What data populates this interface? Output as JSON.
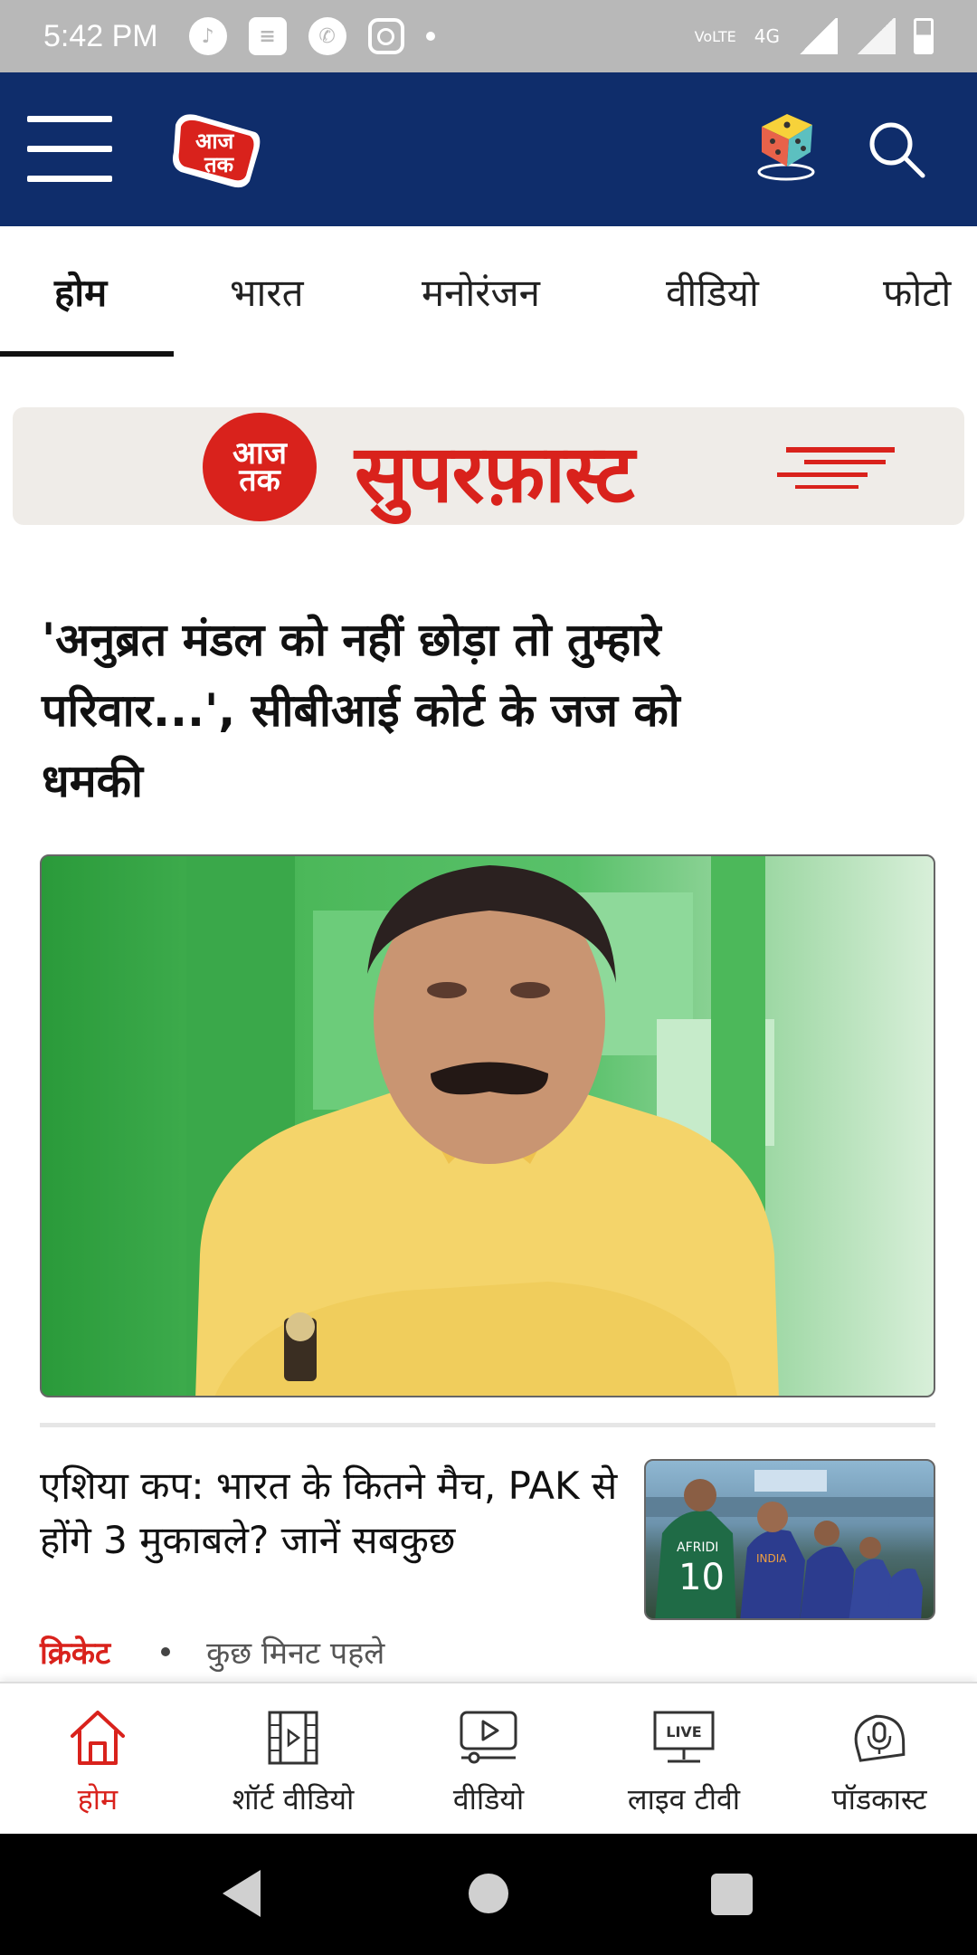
{
  "status_bar": {
    "time": "5:42 PM",
    "network": "4G",
    "volte": "VoLTE"
  },
  "header": {
    "logo_text_line1": "आज",
    "logo_text_line2": "तक"
  },
  "tabs": [
    {
      "label": "होम",
      "active": true
    },
    {
      "label": "भारत",
      "active": false
    },
    {
      "label": "मनोरंजन",
      "active": false
    },
    {
      "label": "वीडियो",
      "active": false
    },
    {
      "label": "फोटो",
      "active": false
    }
  ],
  "banner": {
    "logo_line1": "आज",
    "logo_line2": "तक",
    "title": "सुपरफ़ास्ट"
  },
  "headline": "'अनुब्रत मंडल को नहीं छोड़ा तो तुम्हारे परिवार...', सीबीआई कोर्ट के जज को धमकी",
  "story": {
    "title": "एशिया कप: भारत के कितने मैच, PAK से होंगे 3 मुकाबले? जानें सबकुछ",
    "category": "क्रिकेट",
    "time": "कुछ मिनट पहले",
    "thumb_text_1": "AFRIDI",
    "thumb_text_2": "10",
    "thumb_text_3": "INDIA"
  },
  "bottom_nav": [
    {
      "label": "होम",
      "icon": "home-icon",
      "active": true
    },
    {
      "label": "शॉर्ट वीडियो",
      "icon": "film-icon",
      "active": false
    },
    {
      "label": "वीडियो",
      "icon": "video-play-icon",
      "active": false
    },
    {
      "label": "लाइव टीवी",
      "icon": "live-tv-icon",
      "active": false,
      "icon_text": "LIVE"
    },
    {
      "label": "पॉडकास्ट",
      "icon": "podcast-icon",
      "active": false
    }
  ],
  "colors": {
    "header_bg": "#0f2d6b",
    "accent_red": "#d9221c",
    "status_bar_bg": "#b8b8b8"
  }
}
